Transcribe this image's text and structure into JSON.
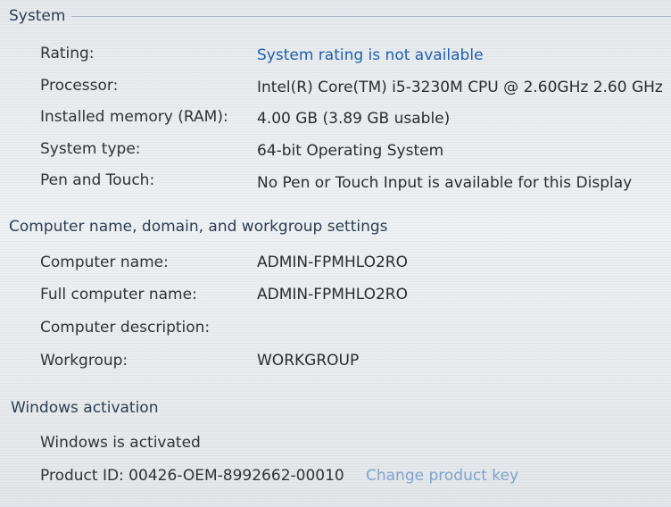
{
  "system": {
    "title": "System",
    "rows": [
      {
        "label": "Rating:",
        "value": "System rating is not available"
      },
      {
        "label": "Processor:",
        "value": "Intel(R) Core(TM) i5-3230M CPU @ 2.60GHz   2.60 GHz"
      },
      {
        "label": "Installed memory (RAM):",
        "value": "4.00 GB (3.89 GB usable)"
      },
      {
        "label": "System type:",
        "value": "64-bit Operating System"
      },
      {
        "label": "Pen and Touch:",
        "value": "No Pen or Touch Input is available for this Display"
      }
    ]
  },
  "computer": {
    "title": "Computer name, domain, and workgroup settings",
    "rows": [
      {
        "label": "Computer name:",
        "value": "ADMIN-FPMHLO2RO"
      },
      {
        "label": "Full computer name:",
        "value": "ADMIN-FPMHLO2RO"
      },
      {
        "label": "Computer description:",
        "value": ""
      },
      {
        "label": "Workgroup:",
        "value": "WORKGROUP"
      }
    ]
  },
  "activation": {
    "title": "Windows activation",
    "status": "Windows is activated",
    "product_id": "Product ID: 00426-OEM-8992662-00010",
    "change_key_link": "Change product key"
  }
}
